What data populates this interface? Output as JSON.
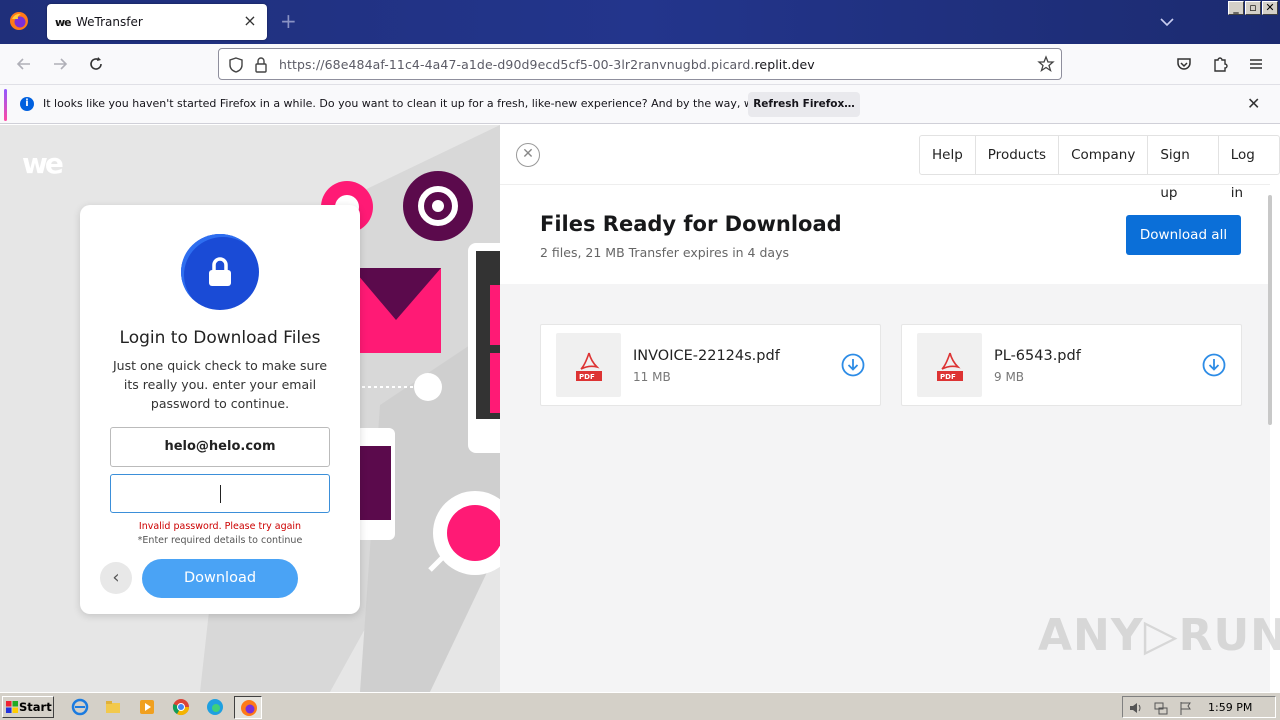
{
  "browser": {
    "tab_title": "WeTransfer",
    "tab_favicon_text": "we",
    "new_tab_symbol": "+",
    "url_prefix": "https://68e484af-11c4-4a47-a1de-d90d9ecd5cf5-00-3lr2ranvnugbd.picard.",
    "url_host": "replit.dev",
    "window_buttons": [
      "_",
      "▫",
      "✕"
    ]
  },
  "notification": {
    "text": "It looks like you haven't started Firefox in a while. Do you want to clean it up for a fresh, like-new experience? And by the way, welcome back!",
    "button_label": "Refresh Firefox…",
    "info_symbol": "i",
    "close_symbol": "✕"
  },
  "page": {
    "logo_text": "we",
    "login": {
      "title": "Login to Download Files",
      "description": "Just one quick check to make sure its really you. enter your email password to continue.",
      "email_value": "helo@helo.com",
      "error_text": "Invalid password. Please try again",
      "required_text": "*Enter required details to continue",
      "back_symbol": "‹",
      "download_label": "Download"
    },
    "nav": [
      "Help",
      "Products",
      "Company",
      "Sign up",
      "Log in"
    ],
    "close_symbol": "✕",
    "files_title": "Files Ready for Download",
    "files_subtitle": "2 files, 21 MB Transfer expires in 4 days",
    "download_all_label": "Download all",
    "files": [
      {
        "name": "INVOICE-22124s.pdf",
        "size": "11 MB",
        "badge": "PDF"
      },
      {
        "name": "PL-6543.pdf",
        "size": "9 MB",
        "badge": "PDF"
      }
    ]
  },
  "watermark": "ANY▷RUN",
  "taskbar": {
    "start_label": "Start",
    "clock": "1:59 PM"
  },
  "colors": {
    "accent_blue": "#0b6fd8",
    "download_button": "#4aa3f5",
    "error": "#cc0000",
    "brand_pink": "#ff1a75",
    "brand_purple": "#5b0a4c"
  },
  "icons": [
    "firefox-icon",
    "shield-icon",
    "lock-icon",
    "star-icon",
    "pocket-icon",
    "extensions-icon",
    "menu-icon",
    "back-icon",
    "forward-icon",
    "reload-icon",
    "pdf-icon",
    "download-circle-icon"
  ]
}
